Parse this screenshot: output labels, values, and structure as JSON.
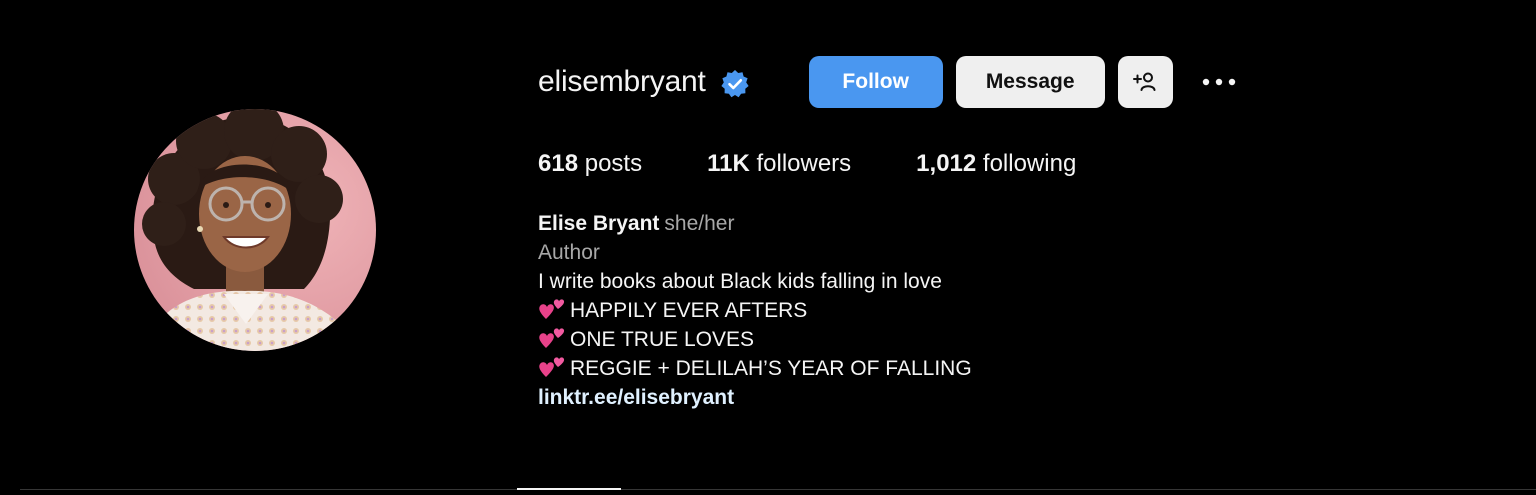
{
  "profile": {
    "username": "elisembryant",
    "verified_badge_icon": "verified-badge-icon",
    "full_name": "Elise Bryant",
    "pronouns": "she/her",
    "category": "Author",
    "bio_lines": [
      "I write books about Black kids falling in love",
      "HAPPILY EVER AFTERS",
      "ONE TRUE LOVES",
      "REGGIE + DELILAH’S YEAR OF FALLING"
    ],
    "bio_emoji_icon": "two-hearts-icon",
    "link": "linktr.ee/elisebryant"
  },
  "actions": {
    "follow_label": "Follow",
    "message_label": "Message",
    "suggest_icon": "add-person-icon",
    "more_icon": "more-options-icon"
  },
  "stats": {
    "posts_count": "618",
    "posts_label": "posts",
    "followers_count": "11K",
    "followers_label": "followers",
    "following_count": "1,012",
    "following_label": "following"
  },
  "colors": {
    "background": "#000000",
    "follow_button": "#4a97f0",
    "secondary_button": "#efefef",
    "muted_text": "#a8a8a8",
    "link_text": "#e0f1ff",
    "avatar_background": "#e8a2a8"
  }
}
